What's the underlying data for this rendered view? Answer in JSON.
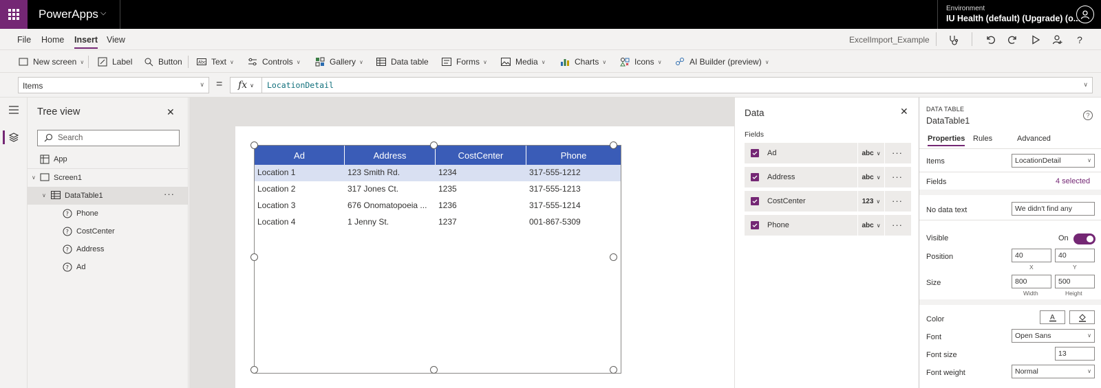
{
  "topbar": {
    "app_name": "PowerApps",
    "environment_label": "Environment",
    "environment_value": "IU Health (default) (Upgrade) (o..."
  },
  "menubar": {
    "tabs": [
      "File",
      "Home",
      "Insert",
      "View"
    ],
    "active_tab": "Insert",
    "app_file_name": "ExcelImport_Example"
  },
  "ribbon": {
    "items": [
      {
        "label": "New screen",
        "icon": "new-screen-icon",
        "dropdown": true
      },
      {
        "label": "Label",
        "icon": "label-icon",
        "dropdown": false
      },
      {
        "label": "Button",
        "icon": "button-icon",
        "dropdown": false
      },
      {
        "label": "Text",
        "icon": "text-icon",
        "dropdown": true
      },
      {
        "label": "Controls",
        "icon": "controls-icon",
        "dropdown": true
      },
      {
        "label": "Gallery",
        "icon": "gallery-icon",
        "dropdown": true
      },
      {
        "label": "Data table",
        "icon": "data-table-icon",
        "dropdown": false
      },
      {
        "label": "Forms",
        "icon": "forms-icon",
        "dropdown": true
      },
      {
        "label": "Media",
        "icon": "media-icon",
        "dropdown": true
      },
      {
        "label": "Charts",
        "icon": "charts-icon",
        "dropdown": true
      },
      {
        "label": "Icons",
        "icon": "icons-icon",
        "dropdown": true
      },
      {
        "label": "AI Builder (preview)",
        "icon": "ai-builder-icon",
        "dropdown": true
      }
    ]
  },
  "formula": {
    "property": "Items",
    "equals": "=",
    "fx": "fx",
    "value": "LocationDetail"
  },
  "treeview": {
    "title": "Tree view",
    "search_placeholder": "Search",
    "items": [
      {
        "label": "App",
        "icon": "app-icon"
      },
      {
        "label": "Screen1",
        "icon": "screen-icon"
      },
      {
        "label": "DataTable1",
        "icon": "table-icon"
      },
      {
        "label": "Phone",
        "icon": "field-icon"
      },
      {
        "label": "CostCenter",
        "icon": "field-icon"
      },
      {
        "label": "Address",
        "icon": "field-icon"
      },
      {
        "label": "Ad",
        "icon": "field-icon"
      }
    ],
    "more": "···"
  },
  "datatable": {
    "columns": [
      "Ad",
      "Address",
      "CostCenter",
      "Phone"
    ],
    "rows": [
      [
        "Location 1",
        "123 Smith Rd.",
        "1234",
        "317-555-1212"
      ],
      [
        "Location 2",
        "317 Jones Ct.",
        "1235",
        "317-555-1213"
      ],
      [
        "Location 3",
        "676 Onomatopoeia ...",
        "1236",
        "317-555-1214"
      ],
      [
        "Location 4",
        "1 Jenny St.",
        "1237",
        "001-867-5309"
      ]
    ],
    "header_color": "#3a5cb7",
    "selected_row_color": "#d9e0f2"
  },
  "data_pane": {
    "title": "Data",
    "fields_label": "Fields",
    "fields": [
      {
        "name": "Ad",
        "type": "abc",
        "checked": true
      },
      {
        "name": "Address",
        "type": "abc",
        "checked": true
      },
      {
        "name": "CostCenter",
        "type": "123",
        "checked": true
      },
      {
        "name": "Phone",
        "type": "abc",
        "checked": true
      }
    ],
    "more": "···"
  },
  "properties": {
    "control_type": "DATA TABLE",
    "control_name": "DataTable1",
    "tabs": [
      "Properties",
      "Rules",
      "Advanced"
    ],
    "active_tab": "Properties",
    "items_label": "Items",
    "items_value": "LocationDetail",
    "fields_label": "Fields",
    "fields_value": "4 selected",
    "no_data_label": "No data text",
    "no_data_value": "We didn't find any",
    "visible_label": "Visible",
    "visible_value": "On",
    "position_label": "Position",
    "position_x": "40",
    "position_y": "40",
    "x_label": "X",
    "y_label": "Y",
    "size_label": "Size",
    "size_width": "800",
    "size_height": "500",
    "width_label": "Width",
    "height_label": "Height",
    "color_label": "Color",
    "font_label": "Font",
    "font_value": "Open Sans",
    "font_size_label": "Font size",
    "font_size_value": "13",
    "font_weight_label": "Font weight",
    "font_weight_value": "Normal"
  },
  "colors": {
    "brand": "#742774",
    "topbar": "#000000"
  }
}
